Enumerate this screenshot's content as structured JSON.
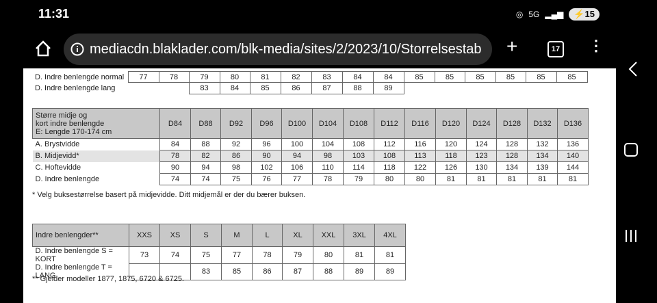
{
  "status": {
    "time": "11:31",
    "battery": "15",
    "net_badge": "5G"
  },
  "browser": {
    "url": "mediacdn.blaklader.com/blk-media/sites/2/2023/10/Storrelsestab",
    "tab_count": "17",
    "plus": "+",
    "menu": "⋮"
  },
  "top_table": {
    "rows": [
      {
        "label": "D. Indre benlengde normal",
        "values": [
          "77",
          "78",
          "79",
          "80",
          "81",
          "82",
          "83",
          "84",
          "84",
          "85",
          "85",
          "85",
          "85",
          "85",
          "85"
        ]
      },
      {
        "label": "D. Indre benlengde lang",
        "values": [
          "",
          "",
          "83",
          "84",
          "85",
          "86",
          "87",
          "88",
          "89",
          "",
          "",
          "",
          "",
          "",
          ""
        ]
      }
    ]
  },
  "mid_table": {
    "header_label": [
      "Større midje og",
      "kort indre benlengde",
      "E: Lengde 170-174 cm"
    ],
    "columns": [
      "D84",
      "D88",
      "D92",
      "D96",
      "D100",
      "D104",
      "D108",
      "D112",
      "D116",
      "D120",
      "D124",
      "D128",
      "D132",
      "D136"
    ],
    "rows": [
      {
        "label": "A. Brystvidde",
        "values": [
          "84",
          "88",
          "92",
          "96",
          "100",
          "104",
          "108",
          "112",
          "116",
          "120",
          "124",
          "128",
          "132",
          "136"
        ]
      },
      {
        "label": "B. Midjevidd*",
        "values": [
          "78",
          "82",
          "86",
          "90",
          "94",
          "98",
          "103",
          "108",
          "113",
          "118",
          "123",
          "128",
          "134",
          "140"
        ]
      },
      {
        "label": "C. Hoftevidde",
        "values": [
          "90",
          "94",
          "98",
          "102",
          "106",
          "110",
          "114",
          "118",
          "122",
          "126",
          "130",
          "134",
          "139",
          "144"
        ]
      },
      {
        "label": "D. Indre benlengde",
        "values": [
          "74",
          "74",
          "75",
          "76",
          "77",
          "78",
          "79",
          "80",
          "80",
          "81",
          "81",
          "81",
          "81",
          "81"
        ]
      }
    ],
    "note": "* Velg buksestørrelse basert på midjevidde. Ditt midjemål er der du bærer buksen."
  },
  "bottom_table": {
    "header_label": "Indre benlengder**",
    "columns": [
      "XXS",
      "XS",
      "S",
      "M",
      "L",
      "XL",
      "XXL",
      "3XL",
      "4XL"
    ],
    "rows": [
      {
        "label": "D. Indre benlengde S = KORT",
        "values": [
          "73",
          "74",
          "75",
          "77",
          "78",
          "79",
          "80",
          "81",
          "81"
        ]
      },
      {
        "label": "D. Indre benlengde T = LANG",
        "values": [
          "",
          "",
          "83",
          "85",
          "86",
          "87",
          "88",
          "89",
          "89"
        ]
      }
    ],
    "note": "** Gjelder modeller 1877, 1875, 6720 & 6725."
  }
}
